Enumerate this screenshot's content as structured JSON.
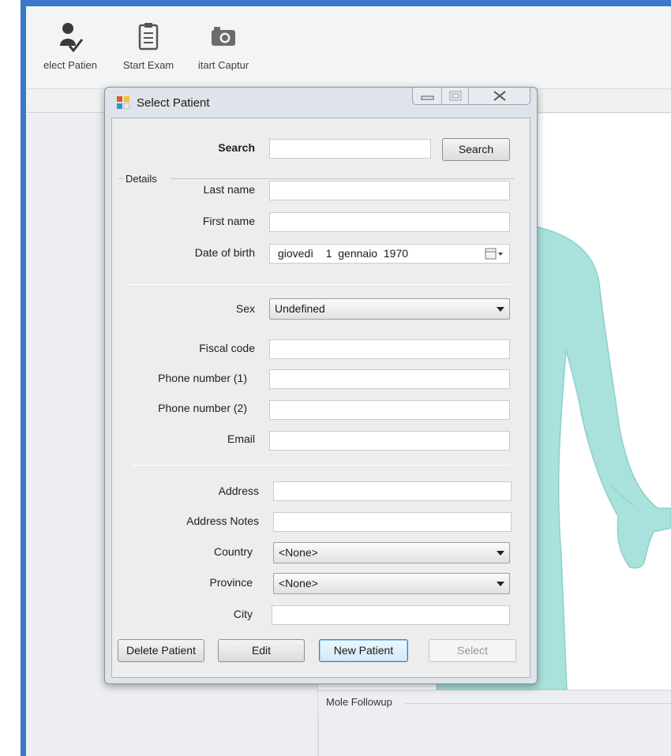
{
  "toolbar": {
    "select_patient_label": "elect Patien",
    "start_exam_label": "Start Exam",
    "start_capture_label": "itart Captur"
  },
  "mole_followup": {
    "title": "Mole Followup"
  },
  "dialog": {
    "title": "Select Patient",
    "search": {
      "label": "Search",
      "value": "",
      "button_label": "Search"
    },
    "details_group_label": "Details",
    "fields": {
      "last_name": {
        "label": "Last name",
        "value": ""
      },
      "first_name": {
        "label": "First name",
        "value": ""
      },
      "date_of_birth": {
        "label": "Date of birth",
        "value": "giovedì    1  gennaio  1970"
      },
      "sex": {
        "label": "Sex",
        "value": "Undefined"
      },
      "fiscal_code": {
        "label": "Fiscal code",
        "value": ""
      },
      "phone1": {
        "label": "Phone number (1)",
        "value": ""
      },
      "phone2": {
        "label": "Phone number (2)",
        "value": ""
      },
      "email": {
        "label": "Email",
        "value": ""
      },
      "address": {
        "label": "Address",
        "value": ""
      },
      "address_notes": {
        "label": "Address Notes",
        "value": ""
      },
      "country": {
        "label": "Country",
        "value": "<None>"
      },
      "province": {
        "label": "Province",
        "value": "<None>"
      },
      "city": {
        "label": "City",
        "value": ""
      }
    },
    "buttons": {
      "delete": "Delete Patient",
      "edit": "Edit",
      "new": "New Patient",
      "select": "Select"
    }
  },
  "colors": {
    "window_frame": "#3a78c9",
    "body_figure": "#a9e2dd",
    "body_figure_outline": "#8fcfca"
  }
}
